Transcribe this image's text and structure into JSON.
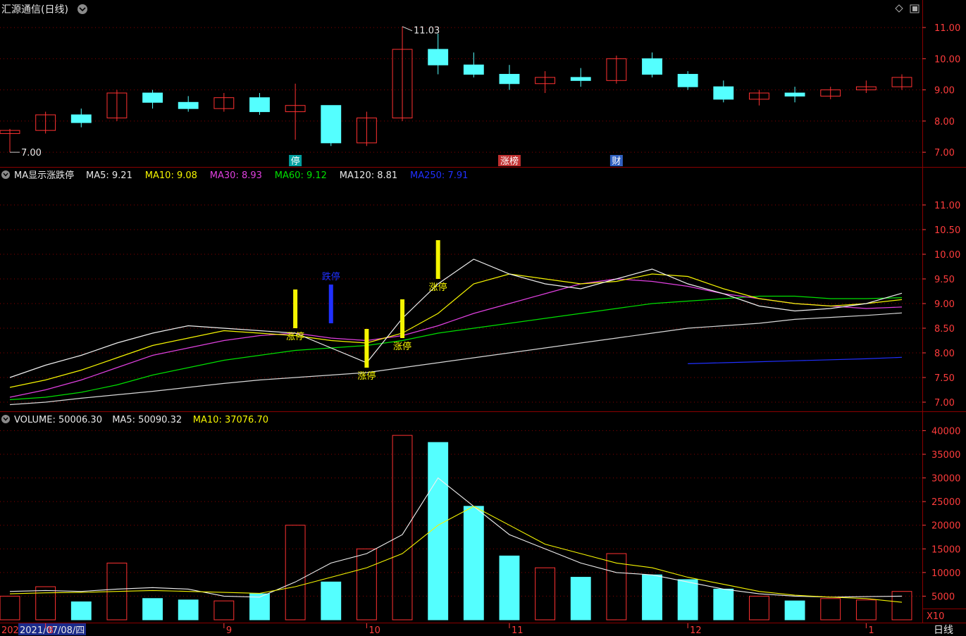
{
  "window": {
    "title": "汇源通信(日线)",
    "period_label": "日线",
    "scale_label": "X10"
  },
  "badges": [
    {
      "text": "停",
      "color": "#00a0a0",
      "at": 8
    },
    {
      "text": "涨榜",
      "color": "#c03030",
      "at": 14
    },
    {
      "text": "财",
      "color": "#3060c0",
      "at": 17
    }
  ],
  "price_panel": {
    "high_label": "11.03",
    "low_label": "7.00",
    "y_ticks": [
      "11.00",
      "10.00",
      "9.00",
      "8.00",
      "7.00"
    ],
    "ylim": [
      6.8,
      11.25
    ]
  },
  "ma_panel": {
    "indicator_name": "MA显示涨跌停",
    "legend": [
      {
        "label": "MA5:",
        "value": "9.21",
        "color": "#e8e8e8"
      },
      {
        "label": "MA10:",
        "value": "9.08",
        "color": "#f5f500"
      },
      {
        "label": "MA30:",
        "value": "8.93",
        "color": "#e040e0"
      },
      {
        "label": "MA60:",
        "value": "9.12",
        "color": "#00e000"
      },
      {
        "label": "MA120:",
        "value": "8.81",
        "color": "#e8e8e8"
      },
      {
        "label": "MA250:",
        "value": "7.91",
        "color": "#2030ff"
      }
    ],
    "y_ticks": [
      "11.00",
      "10.50",
      "10.00",
      "9.50",
      "9.00",
      "8.50",
      "8.00",
      "7.50",
      "7.00"
    ],
    "ylim": [
      6.9,
      11.3
    ],
    "up_limit_text": "涨停",
    "down_limit_text": "跌停"
  },
  "volume_panel": {
    "legend": [
      {
        "label": "VOLUME:",
        "value": "50006.30",
        "color": "#e8e8e8"
      },
      {
        "label": "MA5:",
        "value": "50090.32",
        "color": "#e8e8e8"
      },
      {
        "label": "MA10:",
        "value": "37076.70",
        "color": "#f5f500"
      }
    ],
    "y_ticks": [
      "40000",
      "35000",
      "30000",
      "25000",
      "20000",
      "15000",
      "10000",
      "5000"
    ],
    "ylim": [
      0,
      42000
    ]
  },
  "time_axis": {
    "start_label": "202",
    "cursor_label": "2021/07/08/四",
    "month_labels": [
      {
        "text": "8",
        "at": 1
      },
      {
        "text": "9",
        "at": 6
      },
      {
        "text": "10",
        "at": 10
      },
      {
        "text": "11",
        "at": 14
      },
      {
        "text": "12",
        "at": 19
      },
      {
        "text": "1",
        "at": 24
      }
    ]
  },
  "colors": {
    "up": "#ff3232",
    "down": "#54ffff",
    "grid": "#8b0000",
    "axis_text": "#ff3c3c"
  },
  "chart_data": {
    "type": "candlestick",
    "ohlc": [
      {
        "o": 7.6,
        "h": 7.75,
        "l": 7.0,
        "c": 7.7,
        "v": 5000
      },
      {
        "o": 7.7,
        "h": 8.3,
        "l": 7.6,
        "c": 8.2,
        "v": 7000
      },
      {
        "o": 8.2,
        "h": 8.4,
        "l": 7.8,
        "c": 7.95,
        "v": 3800
      },
      {
        "o": 8.1,
        "h": 9.0,
        "l": 8.0,
        "c": 8.9,
        "v": 12000
      },
      {
        "o": 8.9,
        "h": 9.0,
        "l": 8.4,
        "c": 8.6,
        "v": 4500
      },
      {
        "o": 8.6,
        "h": 8.8,
        "l": 8.3,
        "c": 8.4,
        "v": 4200
      },
      {
        "o": 8.4,
        "h": 8.9,
        "l": 8.3,
        "c": 8.75,
        "v": 4000
      },
      {
        "o": 8.75,
        "h": 8.9,
        "l": 8.2,
        "c": 8.3,
        "v": 5500
      },
      {
        "o": 8.3,
        "h": 9.2,
        "l": 7.4,
        "c": 8.5,
        "v": 20000
      },
      {
        "o": 8.5,
        "h": 8.5,
        "l": 7.2,
        "c": 7.3,
        "v": 8000
      },
      {
        "o": 7.3,
        "h": 8.3,
        "l": 7.2,
        "c": 8.1,
        "v": 15000
      },
      {
        "o": 8.1,
        "h": 11.03,
        "l": 8.0,
        "c": 10.3,
        "v": 39000
      },
      {
        "o": 10.3,
        "h": 10.8,
        "l": 9.5,
        "c": 9.8,
        "v": 37500
      },
      {
        "o": 9.8,
        "h": 10.2,
        "l": 9.4,
        "c": 9.5,
        "v": 24000
      },
      {
        "o": 9.5,
        "h": 9.8,
        "l": 9.0,
        "c": 9.2,
        "v": 13500
      },
      {
        "o": 9.2,
        "h": 9.6,
        "l": 8.9,
        "c": 9.4,
        "v": 11000
      },
      {
        "o": 9.4,
        "h": 9.7,
        "l": 9.1,
        "c": 9.3,
        "v": 9000
      },
      {
        "o": 9.3,
        "h": 10.1,
        "l": 9.2,
        "c": 10.0,
        "v": 14000
      },
      {
        "o": 10.0,
        "h": 10.2,
        "l": 9.4,
        "c": 9.5,
        "v": 9500
      },
      {
        "o": 9.5,
        "h": 9.6,
        "l": 9.0,
        "c": 9.1,
        "v": 8500
      },
      {
        "o": 9.1,
        "h": 9.3,
        "l": 8.6,
        "c": 8.7,
        "v": 6500
      },
      {
        "o": 8.7,
        "h": 9.0,
        "l": 8.5,
        "c": 8.9,
        "v": 5000
      },
      {
        "o": 8.9,
        "h": 9.1,
        "l": 8.6,
        "c": 8.8,
        "v": 4000
      },
      {
        "o": 8.8,
        "h": 9.1,
        "l": 8.7,
        "c": 9.0,
        "v": 4500
      },
      {
        "o": 9.0,
        "h": 9.3,
        "l": 8.9,
        "c": 9.1,
        "v": 4200
      },
      {
        "o": 9.1,
        "h": 9.5,
        "l": 9.0,
        "c": 9.4,
        "v": 6000
      }
    ],
    "ma5": [
      7.5,
      7.75,
      7.95,
      8.2,
      8.4,
      8.55,
      8.5,
      8.45,
      8.4,
      8.1,
      7.8,
      8.7,
      9.4,
      9.9,
      9.6,
      9.4,
      9.3,
      9.5,
      9.7,
      9.4,
      9.2,
      8.95,
      8.85,
      8.9,
      9.0,
      9.21
    ],
    "ma10": [
      7.3,
      7.45,
      7.65,
      7.9,
      8.15,
      8.3,
      8.45,
      8.4,
      8.35,
      8.25,
      8.2,
      8.4,
      8.8,
      9.4,
      9.6,
      9.5,
      9.4,
      9.45,
      9.6,
      9.55,
      9.3,
      9.1,
      9.0,
      8.95,
      9.0,
      9.08
    ],
    "ma30": [
      7.1,
      7.25,
      7.45,
      7.7,
      7.95,
      8.1,
      8.25,
      8.35,
      8.4,
      8.3,
      8.25,
      8.35,
      8.55,
      8.8,
      9.0,
      9.2,
      9.4,
      9.5,
      9.45,
      9.35,
      9.2,
      9.1,
      9.0,
      8.95,
      8.9,
      8.93
    ],
    "ma60": [
      7.05,
      7.1,
      7.2,
      7.35,
      7.55,
      7.7,
      7.85,
      7.95,
      8.05,
      8.1,
      8.15,
      8.25,
      8.4,
      8.5,
      8.6,
      8.7,
      8.8,
      8.9,
      9.0,
      9.05,
      9.1,
      9.15,
      9.15,
      9.1,
      9.1,
      9.12
    ],
    "ma120": [
      6.95,
      7.0,
      7.08,
      7.15,
      7.22,
      7.3,
      7.38,
      7.45,
      7.5,
      7.55,
      7.6,
      7.7,
      7.8,
      7.9,
      8.0,
      8.1,
      8.2,
      8.3,
      8.4,
      8.5,
      8.55,
      8.6,
      8.68,
      8.72,
      8.76,
      8.81
    ],
    "ma250": [
      null,
      null,
      null,
      null,
      null,
      null,
      null,
      null,
      null,
      null,
      null,
      null,
      null,
      null,
      null,
      null,
      null,
      null,
      null,
      7.78,
      7.8,
      7.82,
      7.84,
      7.86,
      7.88,
      7.91
    ],
    "vol_ma5": [
      6000,
      6200,
      6000,
      6500,
      6800,
      6500,
      5000,
      4800,
      8000,
      12000,
      14000,
      18000,
      30000,
      24000,
      18000,
      15000,
      12000,
      10000,
      9500,
      8000,
      6500,
      5500,
      5000,
      4800,
      4900,
      5009
    ],
    "vol_ma10": [
      5500,
      5700,
      5800,
      6000,
      6200,
      6000,
      5800,
      5600,
      7000,
      9000,
      11000,
      14000,
      20000,
      24000,
      20000,
      16000,
      14000,
      12000,
      11000,
      9000,
      7500,
      6000,
      5200,
      4800,
      4500,
      3708
    ],
    "markers": [
      {
        "type": "up_limit",
        "at": 8,
        "value": 8.5
      },
      {
        "type": "down_limit",
        "at": 9,
        "value": 8.6
      },
      {
        "type": "up_limit",
        "at": 10,
        "value": 7.7
      },
      {
        "type": "up_limit",
        "at": 11,
        "value": 8.3
      },
      {
        "type": "up_limit",
        "at": 12,
        "value": 9.5
      }
    ]
  }
}
